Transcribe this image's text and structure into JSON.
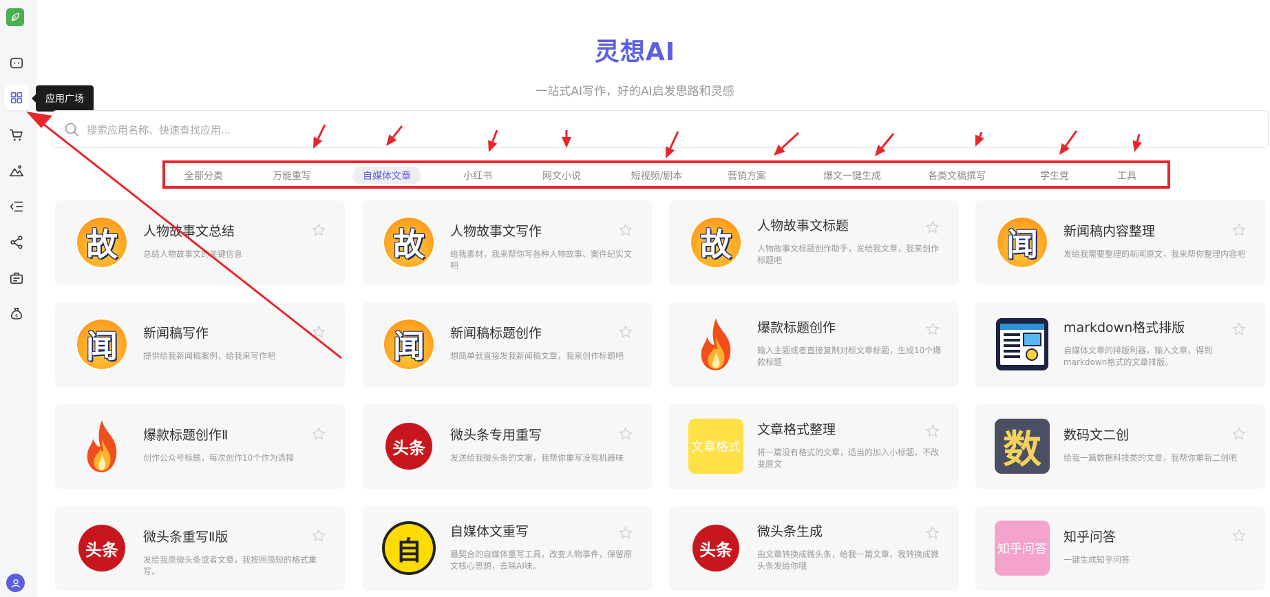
{
  "app": {
    "title": "灵想AI",
    "subtitle": "一站式AI写作，好的AI启发思路和灵感"
  },
  "sidebar": {
    "tooltip": "应用广场",
    "items": [
      {
        "icon": "chat-icon"
      },
      {
        "icon": "grid-icon",
        "active": true
      },
      {
        "icon": "cart-icon"
      },
      {
        "icon": "image-icon"
      },
      {
        "icon": "list-indent-icon"
      },
      {
        "icon": "share-icon"
      },
      {
        "icon": "briefcase-icon"
      },
      {
        "icon": "money-bag-icon"
      }
    ]
  },
  "search": {
    "placeholder": "搜索应用名称、快速查找应用..."
  },
  "categories": [
    {
      "label": "全部分类"
    },
    {
      "label": "万能重写"
    },
    {
      "label": "自媒体文章",
      "active": true
    },
    {
      "label": "小红书"
    },
    {
      "label": "网文小说"
    },
    {
      "label": "短视频/剧本"
    },
    {
      "label": "营销方案"
    },
    {
      "label": "爆文一键生成"
    },
    {
      "label": "各类文稿撰写"
    },
    {
      "label": "学生党"
    },
    {
      "label": "工具"
    }
  ],
  "cards": [
    {
      "title": "人物故事文总结",
      "desc": "总结人物故事文的关键信息",
      "icon": "story-icon",
      "icon_text": "故"
    },
    {
      "title": "人物故事文写作",
      "desc": "给我素材，我来帮你写各种人物故事、案件纪实文吧",
      "icon": "story-icon",
      "icon_text": "故"
    },
    {
      "title": "人物故事文标题",
      "desc": "人物故事文标题创作助手，发给我文章，我来创作标题吧",
      "icon": "story-icon",
      "icon_text": "故"
    },
    {
      "title": "新闻稿内容整理",
      "desc": "发给我需要整理的新闻原文，我来帮你整理内容吧",
      "icon": "news-icon",
      "icon_text": "闻"
    },
    {
      "title": "新闻稿写作",
      "desc": "提供给我新闻稿案例，给我来写作吧",
      "icon": "news-icon",
      "icon_text": "闻"
    },
    {
      "title": "新闻稿标题创作",
      "desc": "想简单就直接发我新闻稿文章，我来创作标题吧",
      "icon": "news-icon",
      "icon_text": "闻"
    },
    {
      "title": "爆款标题创作",
      "desc": "输入主题或者直接复制对标文章标题，生成10个爆款标题",
      "icon": "fire-icon"
    },
    {
      "title": "markdown格式排版",
      "desc": "自媒体文章的排版利器，输入文章，得到markdown格式的文章排版。",
      "icon": "layout-icon"
    },
    {
      "title": "爆款标题创作Ⅱ",
      "desc": "创作公众号标题，每次创作10个作为选择",
      "icon": "fire-icon"
    },
    {
      "title": "微头条专用重写",
      "desc": "发送给我微头条的文案，我帮你重写没有机器味",
      "icon": "toutiao-icon",
      "icon_text": "头条"
    },
    {
      "title": "文章格式整理",
      "desc": "将一篇没有格式的文章，适当的加入小标题，不改变原文",
      "icon": "format-icon",
      "icon_text": "文章格式"
    },
    {
      "title": "数码文二创",
      "desc": "给我一篇数据科技类的文章，我帮你重新二创吧",
      "icon": "digital-icon",
      "icon_text": "数"
    },
    {
      "title": "微头条重写Ⅱ版",
      "desc": "发给我原微头条或者文章，我按照简短的格式重写。",
      "icon": "toutiao-icon",
      "icon_text": "头条"
    },
    {
      "title": "自媒体文重写",
      "desc": "最契合的自媒体重写工具，改变人物事件，保留原文核心思想，去除AI味。",
      "icon": "media-icon",
      "icon_text": "自"
    },
    {
      "title": "微头条生成",
      "desc": "由文章转换成微头条，给我一篇文章，我转换成微头条发给你哦",
      "icon": "toutiao-icon",
      "icon_text": "头条"
    },
    {
      "title": "知乎问答",
      "desc": "一键生成知乎问答",
      "icon": "zhihu-icon",
      "icon_text": "知乎问答"
    }
  ],
  "colors": {
    "accent": "#5b5fe0",
    "annotation": "#e8262b",
    "card_bg": "#f7f7f8"
  }
}
